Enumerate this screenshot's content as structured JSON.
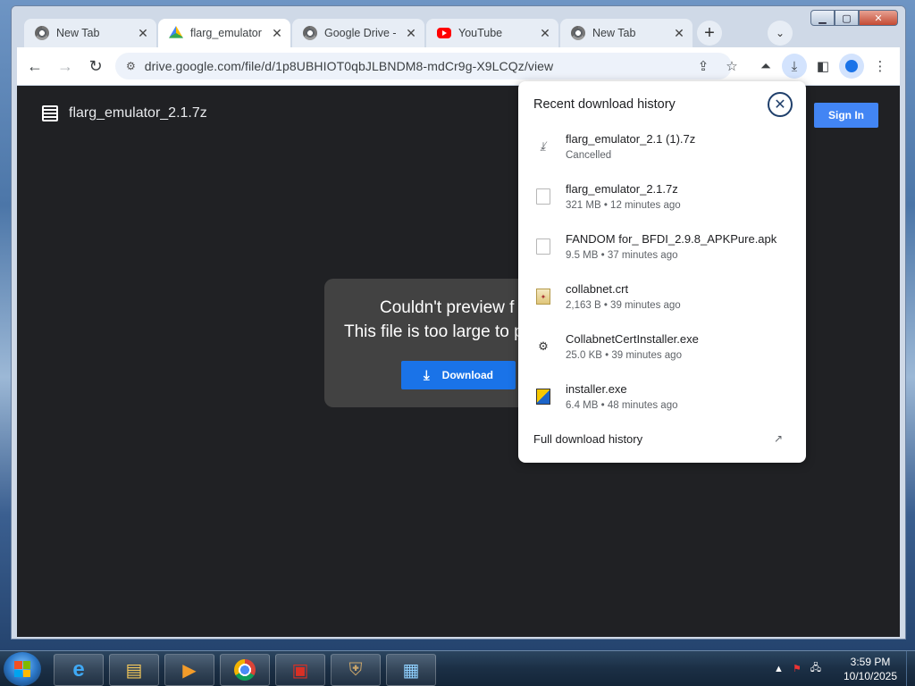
{
  "browser": {
    "tabs": [
      {
        "label": "New Tab",
        "icon": "chrome-icon",
        "active": false
      },
      {
        "label": "flarg_emulator",
        "icon": "google-drive-icon",
        "active": true
      },
      {
        "label": "Google Drive -",
        "icon": "chrome-icon",
        "active": false
      },
      {
        "label": "YouTube",
        "icon": "youtube-icon",
        "active": false
      },
      {
        "label": "New Tab",
        "icon": "chrome-icon",
        "active": false
      }
    ],
    "new_tab_symbol": "+",
    "tab_close_symbol": "✕",
    "address": "drive.google.com/file/d/1p8UBHIOT0qbJLBNDM8-mdCr9g-X9LCQz/view"
  },
  "viewer": {
    "file_title": "flarg_emulator_2.1.7z",
    "sign_in_label": "Sign In",
    "preview_line1": "Couldn't preview f",
    "preview_line2": "This file is too large to p",
    "download_label": "Download"
  },
  "downloads_popup": {
    "title": "Recent download history",
    "items": [
      {
        "name": "flarg_emulator_2.1 (1).7z",
        "meta": "Cancelled",
        "icon": "cancelled-download-icon"
      },
      {
        "name": "flarg_emulator_2.1.7z",
        "meta": "321 MB • 12 minutes ago",
        "icon": "file-icon"
      },
      {
        "name": "FANDOM for_ BFDI_2.9.8_APKPure.apk",
        "meta": "9.5 MB • 37 minutes ago",
        "icon": "file-icon"
      },
      {
        "name": "collabnet.crt",
        "meta": "2,163 B • 39 minutes ago",
        "icon": "certificate-icon"
      },
      {
        "name": "CollabnetCertInstaller.exe",
        "meta": "25.0 KB • 39 minutes ago",
        "icon": "exe-icon"
      },
      {
        "name": "installer.exe",
        "meta": "6.4 MB • 48 minutes ago",
        "icon": "exe-icon"
      }
    ],
    "full_history_label": "Full download history"
  },
  "taskbar": {
    "time": "3:59 PM",
    "date": "10/10/2025"
  },
  "colors": {
    "accent_blue": "#1a73e8",
    "viewer_bg": "#202124",
    "popup_close": "#1f3f6b"
  }
}
